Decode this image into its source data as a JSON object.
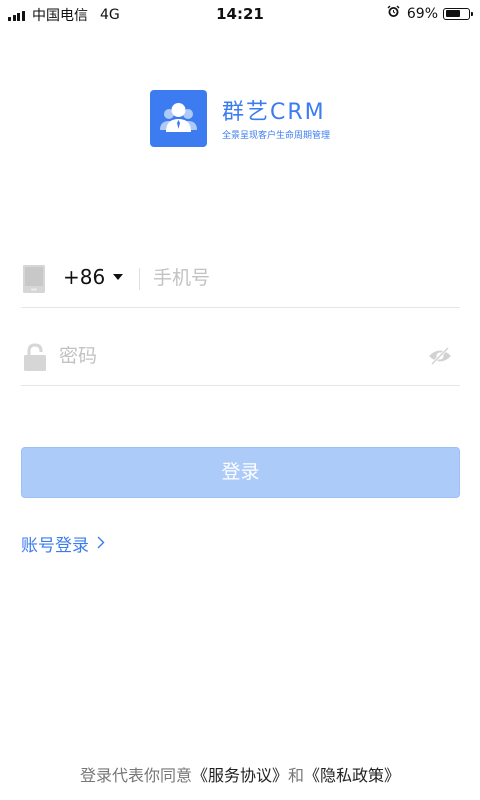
{
  "status_bar": {
    "carrier": "中国电信",
    "network": "4G",
    "time": "14:21",
    "battery": "69%",
    "battery_level": 0.69
  },
  "brand": {
    "name": "群艺CRM",
    "tagline": "全景呈现客户生命周期管理",
    "color": "#3d7cf0"
  },
  "phone": {
    "country_code": "+86",
    "placeholder": "手机号"
  },
  "password": {
    "placeholder": "密码"
  },
  "login_button": {
    "label": "登录",
    "color": "#adcbf9"
  },
  "account_login": {
    "label": "账号登录"
  },
  "footer": {
    "prefix": "登录代表你同意",
    "terms": "《服务协议》",
    "and": "和",
    "privacy": "《隐私政策》"
  },
  "icons": [
    "signal-icon",
    "alarm-icon",
    "battery-icon",
    "phone-device-icon",
    "lock-icon",
    "eye-off-icon",
    "chevron-right-icon",
    "user-group-icon"
  ]
}
